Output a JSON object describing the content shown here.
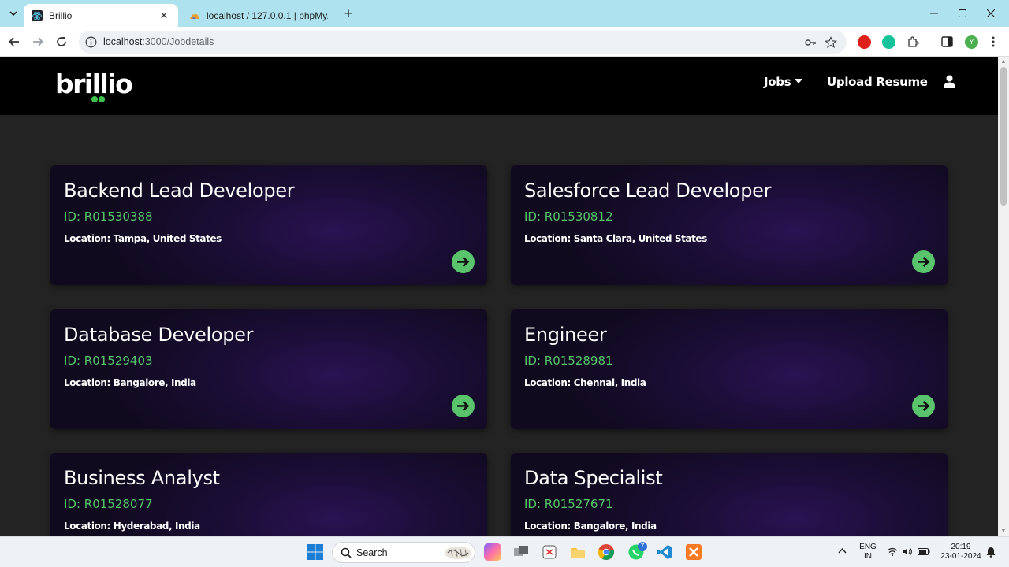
{
  "browser": {
    "tabs": [
      {
        "title": "Brillio",
        "active": true
      },
      {
        "title": "localhost / 127.0.0.1 | phpMyAdmin",
        "active": false
      }
    ],
    "url_host": "localhost",
    "url_path": ":3000/Jobdetails",
    "profile_initial": "Y"
  },
  "site": {
    "logo_text": "brillio",
    "nav": {
      "jobs": "Jobs",
      "upload": "Upload Resume"
    }
  },
  "jobs": [
    {
      "title": "Backend Lead Developer",
      "id": "ID: R01530388",
      "location": "Location: Tampa, United States"
    },
    {
      "title": "Salesforce Lead Developer",
      "id": "ID: R01530812",
      "location": "Location: Santa Clara, United States"
    },
    {
      "title": "Database Developer",
      "id": "ID: R01529403",
      "location": "Location: Bangalore, India"
    },
    {
      "title": "Engineer",
      "id": "ID: R01528981",
      "location": "Location: Chennai, India"
    },
    {
      "title": "Business Analyst",
      "id": "ID: R01528077",
      "location": "Location: Hyderabad, India"
    },
    {
      "title": "Data Specialist",
      "id": "ID: R01527671",
      "location": "Location: Bangalore, India"
    }
  ],
  "taskbar": {
    "search_label": "Search",
    "whatsapp_badge": "7",
    "lang_line1": "ENG",
    "lang_line2": "IN",
    "time": "20:19",
    "date": "23-01-2024"
  },
  "colors": {
    "accent_green": "#59c46b",
    "header_bg": "#000000",
    "page_bg": "#232323"
  }
}
